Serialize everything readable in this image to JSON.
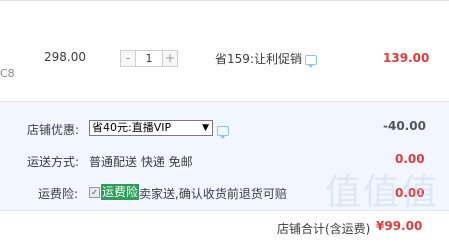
{
  "item": {
    "sku_suffix": "C8",
    "unit_price": "298.00",
    "quantity": "1",
    "qty_minus": "-",
    "qty_plus": "+",
    "discount_label": "省159:让利促销",
    "item_total": "139.00"
  },
  "shop": {
    "discount_label": "店铺优惠:",
    "coupon_selected": "省40元:直播VIP",
    "discount_value": "-40.00",
    "shipping_label": "运送方式:",
    "shipping_value": "普通配送 快递 免邮",
    "shipping_cost": "0.00",
    "insurance_label": "运费险:",
    "insurance_tag": "运费险",
    "insurance_text": "卖家送,确认收货前退货可赔",
    "insurance_cost": "0.00",
    "insurance_checked": true
  },
  "footer": {
    "total_label": "店铺合计(含运费)",
    "total_value": "¥99.00"
  },
  "watermark": "值值值",
  "colors": {
    "price_red": "#e4393c",
    "panel_bg": "#f2f7ff",
    "insurance_green": "#2e9d5a",
    "icon_blue": "#8cc4ee"
  }
}
